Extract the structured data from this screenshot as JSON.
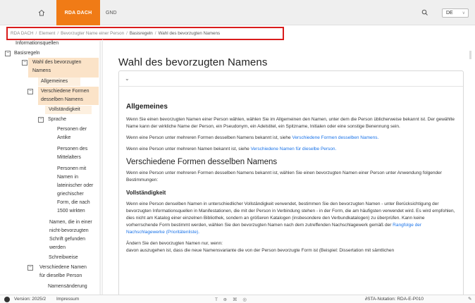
{
  "nav": {
    "tabs": [
      "RDA DACH",
      "GND"
    ],
    "lang": "DE"
  },
  "breadcrumb": [
    "RDA DACH",
    "Element",
    "Bevorzugter Name einer Person",
    "Basisregeln",
    "Wahl des bevorzugten Namens"
  ],
  "sidebar": {
    "items": [
      "Informationsquellen",
      "Basisregeln",
      "Wahl des bevorzugten",
      "Namens",
      "Allgemeines",
      "Verschiedene Formen",
      "desselben Namens",
      "Vollständigkeit",
      "Sprache",
      "Personen der",
      "Antike",
      "Personen des",
      "Mittelalters",
      "Personen mit",
      "Namen in",
      "lateinischer oder",
      "griechischer",
      "Form, die nach",
      "1500 wirkten",
      "Namen, die in einer",
      "nicht-bevorzugten",
      "Schrift gefunden",
      "werden",
      "Schreibweise",
      "Verschiedene Namen",
      "für dieselbe Person",
      "Namensänderung"
    ]
  },
  "main": {
    "title": "Wahl des bevorzugten Namens",
    "s1_title": "Allgemeines",
    "s1_p1": "Wenn Sie einen bevorzugten Namen einer Person wählen, wählen Sie im Allgemeinen den Namen, unter dem die Person üblicherweise bekannt ist. Der gewählte Name kann der wirkliche Name der Person, ein Pseudonym, ein Adelstitel, ein Spitzname, Initialen oder eine sonstige Benennung sein.",
    "s1_p2_text": "Wenn eine Person unter mehreren Formen desselben Namens bekannt ist, siehe ",
    "s1_p2_link": "Verschiedene Formen desselben Namens.",
    "s1_p3_text": "Wenn eine Person unter mehreren Namen bekannt ist, siehe ",
    "s1_p3_link": "Verschiedene Namen für dieselbe Person.",
    "s2_title": "Verschiedene Formen desselben Namens",
    "s2_p1": "Wenn eine Person unter mehreren Formen desselben Namens bekannt ist, wählen Sie einen bevorzugten Namen einer Person unter Anwendung folgender Bestimmungen:",
    "s3_title": "Vollständigkeit",
    "s3_p1_text": "Wenn eine Person denselben Namen in unterschiedlicher Vollständigkeit verwendet, bestimmen Sie den bevorzugten Namen - unter Berücksichtigung der bevorzugten Informationsquellen in Manifestationen, die mit der Person in Verbindung stehen - in der Form, die am häufigsten verwendet wird. Es wird empfohlen, dies nicht am Katalog einer einzelnen Bibliothek, sondern an größeren Katalogen (insbesondere den Verbundkatalogen) zu überprüfen. Kann keine vorherrschende Form bestimmt werden, wählen Sie den bevorzugten Namen nach dem zutreffenden Nachschlagewerk gemäß der ",
    "s3_p1_link": "Rangfolge der Nachschlagewerke (Prioritätenliste).",
    "s3_p2": "Ändern Sie den bevorzugten Namen nur, wenn:",
    "s3_p3": "davon auszugehen ist, dass die neue Namensvariante die von der Person bevorzugte Form ist (Beispiel: Dissertation mit sämtlichen"
  },
  "footer": {
    "version": "Version: 2025/2",
    "impressum": "Impressum",
    "mid_icons": "T ⊕ ⌘ ◎",
    "notation": "STA-Notation: RDA-E-P010"
  }
}
